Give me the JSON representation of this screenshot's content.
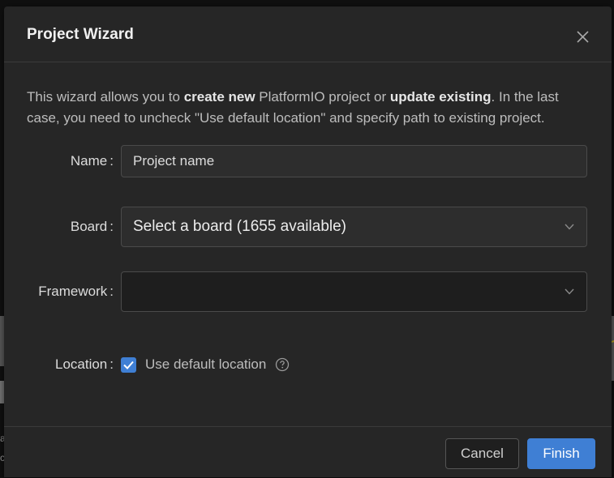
{
  "dialog": {
    "title": "Project Wizard",
    "intro": {
      "part1": "This wizard allows you to ",
      "bold1": "create new",
      "part2": " PlatformIO project or ",
      "bold2": "update existing",
      "part3": ". In the last case, you need to uncheck \"Use default location\" and specify path to existing project."
    }
  },
  "form": {
    "name": {
      "label": "Name",
      "colon": ":",
      "value": "",
      "placeholder": "Project name"
    },
    "board": {
      "label": "Board",
      "colon": ":",
      "selected": "Select a board (1655 available)"
    },
    "framework": {
      "label": "Framework",
      "colon": ":",
      "selected": ""
    },
    "location": {
      "label": "Location",
      "colon": ":",
      "checkbox_label": "Use default location",
      "checked": true
    }
  },
  "footer": {
    "cancel_label": "Cancel",
    "finish_label": "Finish"
  },
  "icons": {
    "close": "close-icon",
    "chevron": "chevron-down-icon",
    "check": "checkmark-icon",
    "help": "question-circle-icon"
  },
  "colors": {
    "accent": "#3f7fd4",
    "dialog_bg": "#262626",
    "border": "#4a4a4a"
  },
  "background": {
    "partial_text_1": "a",
    "partial_text_2": "c"
  }
}
